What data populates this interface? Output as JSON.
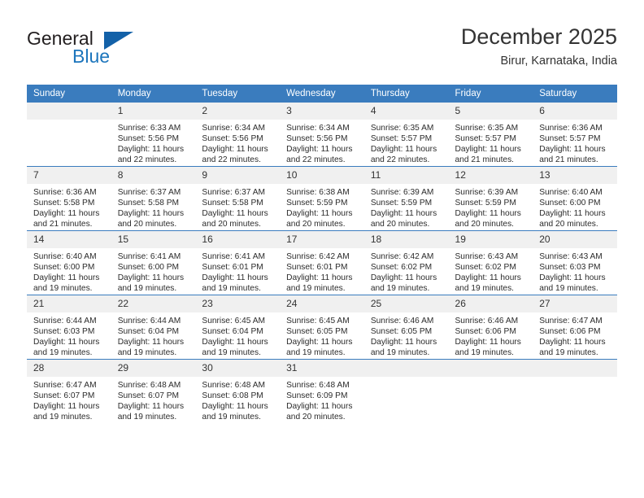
{
  "brand": {
    "word1": "General",
    "word2": "Blue",
    "accent_color": "#1c75bc",
    "triangle_color": "#1361a8"
  },
  "header": {
    "month_title": "December 2025",
    "location": "Birur, Karnataka, India"
  },
  "calendar": {
    "header_bg": "#3a7cbe",
    "daynum_bg": "#f0f0f0",
    "weekdays": [
      "Sunday",
      "Monday",
      "Tuesday",
      "Wednesday",
      "Thursday",
      "Friday",
      "Saturday"
    ],
    "weeks": [
      [
        {
          "day": "",
          "lines": []
        },
        {
          "day": "1",
          "lines": [
            "Sunrise: 6:33 AM",
            "Sunset: 5:56 PM",
            "Daylight: 11 hours",
            "and 22 minutes."
          ]
        },
        {
          "day": "2",
          "lines": [
            "Sunrise: 6:34 AM",
            "Sunset: 5:56 PM",
            "Daylight: 11 hours",
            "and 22 minutes."
          ]
        },
        {
          "day": "3",
          "lines": [
            "Sunrise: 6:34 AM",
            "Sunset: 5:56 PM",
            "Daylight: 11 hours",
            "and 22 minutes."
          ]
        },
        {
          "day": "4",
          "lines": [
            "Sunrise: 6:35 AM",
            "Sunset: 5:57 PM",
            "Daylight: 11 hours",
            "and 22 minutes."
          ]
        },
        {
          "day": "5",
          "lines": [
            "Sunrise: 6:35 AM",
            "Sunset: 5:57 PM",
            "Daylight: 11 hours",
            "and 21 minutes."
          ]
        },
        {
          "day": "6",
          "lines": [
            "Sunrise: 6:36 AM",
            "Sunset: 5:57 PM",
            "Daylight: 11 hours",
            "and 21 minutes."
          ]
        }
      ],
      [
        {
          "day": "7",
          "lines": [
            "Sunrise: 6:36 AM",
            "Sunset: 5:58 PM",
            "Daylight: 11 hours",
            "and 21 minutes."
          ]
        },
        {
          "day": "8",
          "lines": [
            "Sunrise: 6:37 AM",
            "Sunset: 5:58 PM",
            "Daylight: 11 hours",
            "and 20 minutes."
          ]
        },
        {
          "day": "9",
          "lines": [
            "Sunrise: 6:37 AM",
            "Sunset: 5:58 PM",
            "Daylight: 11 hours",
            "and 20 minutes."
          ]
        },
        {
          "day": "10",
          "lines": [
            "Sunrise: 6:38 AM",
            "Sunset: 5:59 PM",
            "Daylight: 11 hours",
            "and 20 minutes."
          ]
        },
        {
          "day": "11",
          "lines": [
            "Sunrise: 6:39 AM",
            "Sunset: 5:59 PM",
            "Daylight: 11 hours",
            "and 20 minutes."
          ]
        },
        {
          "day": "12",
          "lines": [
            "Sunrise: 6:39 AM",
            "Sunset: 5:59 PM",
            "Daylight: 11 hours",
            "and 20 minutes."
          ]
        },
        {
          "day": "13",
          "lines": [
            "Sunrise: 6:40 AM",
            "Sunset: 6:00 PM",
            "Daylight: 11 hours",
            "and 20 minutes."
          ]
        }
      ],
      [
        {
          "day": "14",
          "lines": [
            "Sunrise: 6:40 AM",
            "Sunset: 6:00 PM",
            "Daylight: 11 hours",
            "and 19 minutes."
          ]
        },
        {
          "day": "15",
          "lines": [
            "Sunrise: 6:41 AM",
            "Sunset: 6:00 PM",
            "Daylight: 11 hours",
            "and 19 minutes."
          ]
        },
        {
          "day": "16",
          "lines": [
            "Sunrise: 6:41 AM",
            "Sunset: 6:01 PM",
            "Daylight: 11 hours",
            "and 19 minutes."
          ]
        },
        {
          "day": "17",
          "lines": [
            "Sunrise: 6:42 AM",
            "Sunset: 6:01 PM",
            "Daylight: 11 hours",
            "and 19 minutes."
          ]
        },
        {
          "day": "18",
          "lines": [
            "Sunrise: 6:42 AM",
            "Sunset: 6:02 PM",
            "Daylight: 11 hours",
            "and 19 minutes."
          ]
        },
        {
          "day": "19",
          "lines": [
            "Sunrise: 6:43 AM",
            "Sunset: 6:02 PM",
            "Daylight: 11 hours",
            "and 19 minutes."
          ]
        },
        {
          "day": "20",
          "lines": [
            "Sunrise: 6:43 AM",
            "Sunset: 6:03 PM",
            "Daylight: 11 hours",
            "and 19 minutes."
          ]
        }
      ],
      [
        {
          "day": "21",
          "lines": [
            "Sunrise: 6:44 AM",
            "Sunset: 6:03 PM",
            "Daylight: 11 hours",
            "and 19 minutes."
          ]
        },
        {
          "day": "22",
          "lines": [
            "Sunrise: 6:44 AM",
            "Sunset: 6:04 PM",
            "Daylight: 11 hours",
            "and 19 minutes."
          ]
        },
        {
          "day": "23",
          "lines": [
            "Sunrise: 6:45 AM",
            "Sunset: 6:04 PM",
            "Daylight: 11 hours",
            "and 19 minutes."
          ]
        },
        {
          "day": "24",
          "lines": [
            "Sunrise: 6:45 AM",
            "Sunset: 6:05 PM",
            "Daylight: 11 hours",
            "and 19 minutes."
          ]
        },
        {
          "day": "25",
          "lines": [
            "Sunrise: 6:46 AM",
            "Sunset: 6:05 PM",
            "Daylight: 11 hours",
            "and 19 minutes."
          ]
        },
        {
          "day": "26",
          "lines": [
            "Sunrise: 6:46 AM",
            "Sunset: 6:06 PM",
            "Daylight: 11 hours",
            "and 19 minutes."
          ]
        },
        {
          "day": "27",
          "lines": [
            "Sunrise: 6:47 AM",
            "Sunset: 6:06 PM",
            "Daylight: 11 hours",
            "and 19 minutes."
          ]
        }
      ],
      [
        {
          "day": "28",
          "lines": [
            "Sunrise: 6:47 AM",
            "Sunset: 6:07 PM",
            "Daylight: 11 hours",
            "and 19 minutes."
          ]
        },
        {
          "day": "29",
          "lines": [
            "Sunrise: 6:48 AM",
            "Sunset: 6:07 PM",
            "Daylight: 11 hours",
            "and 19 minutes."
          ]
        },
        {
          "day": "30",
          "lines": [
            "Sunrise: 6:48 AM",
            "Sunset: 6:08 PM",
            "Daylight: 11 hours",
            "and 19 minutes."
          ]
        },
        {
          "day": "31",
          "lines": [
            "Sunrise: 6:48 AM",
            "Sunset: 6:09 PM",
            "Daylight: 11 hours",
            "and 20 minutes."
          ]
        },
        {
          "day": "",
          "lines": []
        },
        {
          "day": "",
          "lines": []
        },
        {
          "day": "",
          "lines": []
        }
      ]
    ]
  }
}
